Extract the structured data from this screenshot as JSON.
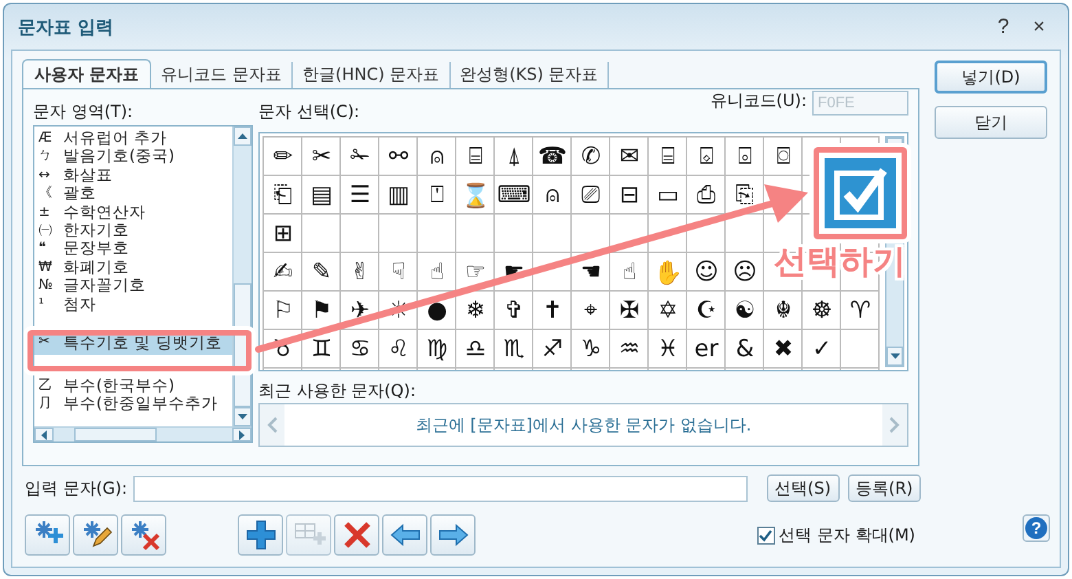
{
  "window": {
    "title": "문자표 입력",
    "controls": [
      "?",
      "×"
    ]
  },
  "tabs": [
    {
      "label": "사용자 문자표",
      "selected": true
    },
    {
      "label": "유니코드 문자표",
      "selected": false
    },
    {
      "label": "한글(HNC) 문자표",
      "selected": false
    },
    {
      "label": "완성형(KS) 문자표",
      "selected": false
    }
  ],
  "area_list": {
    "label": "문자 영역(T):",
    "items": [
      {
        "icon": "Æ",
        "label": "서유럽어 추가",
        "selected": false
      },
      {
        "icon": "ㄅ",
        "label": "발음기호(중국)",
        "selected": false
      },
      {
        "icon": "↔",
        "label": "화살표",
        "selected": false
      },
      {
        "icon": "《",
        "label": "괄호",
        "selected": false
      },
      {
        "icon": "±",
        "label": "수학연산자",
        "selected": false
      },
      {
        "icon": "㈠",
        "label": "한자기호",
        "selected": false
      },
      {
        "icon": "❝",
        "label": "문장부호",
        "selected": false
      },
      {
        "icon": "₩",
        "label": "화폐기호",
        "selected": false
      },
      {
        "icon": "№",
        "label": "글자꼴기호",
        "selected": false
      },
      {
        "icon": "¹",
        "label": "첨자",
        "selected": false
      },
      {
        "icon": "✂",
        "label": "특수기호 및 딩뱃기호",
        "selected": true
      },
      {
        "icon": "乙",
        "label": "부수(한국부수)",
        "selected": false
      },
      {
        "icon": "⺆",
        "label": "부수(한중일부수추가",
        "selected": false
      }
    ]
  },
  "char_select": {
    "label": "문자 선택(C):",
    "unicode_label": "유니코드(U):",
    "unicode_value": "F0FE",
    "unicode_disabled": true,
    "rows": [
      [
        "✏",
        "✂",
        "✁",
        "⚯",
        "⍝",
        "⌸",
        "⍋",
        "☎",
        "✆",
        "✉",
        "⌸",
        "⌺",
        "⌻",
        "⌼",
        null,
        null
      ],
      [
        "⎗",
        "▤",
        "☰",
        "▥",
        "⍞",
        "⌛",
        "⌨",
        "⍝",
        "⎚",
        "⊟",
        "▭",
        "⎙",
        "⎘",
        null,
        null,
        null
      ],
      [
        "⊞",
        null,
        null,
        null,
        null,
        null,
        null,
        null,
        null,
        null,
        null,
        null,
        null,
        null,
        null,
        null
      ],
      [
        "✍",
        "✎",
        "✌",
        "☟",
        "☝",
        "☞",
        "☛",
        null,
        "☚",
        "☝",
        "✋",
        "☺",
        "☹",
        null,
        null,
        null
      ],
      [
        "⚐",
        "⚑",
        "✈",
        "☼",
        "●",
        "❄",
        "✞",
        "✝",
        "⌖",
        "✠",
        "✡",
        "☪",
        "☯",
        "☬",
        "☸",
        "♈"
      ],
      [
        "♉",
        "♊",
        "♋",
        "♌",
        "♍",
        "♎",
        "♏",
        "♐",
        "♑",
        "♒",
        "♓",
        "er",
        "&",
        "✖",
        "✓",
        null
      ]
    ]
  },
  "recent": {
    "label": "최근 사용한 문자(Q):",
    "message": "최근에 [문자표]에서 사용한 문자가 없습니다."
  },
  "input": {
    "label": "입력 문자(G):",
    "buttons": [
      "선택(S)",
      "등록(R)"
    ]
  },
  "toolbar": [
    {
      "kind": "set-add",
      "disabled": false
    },
    {
      "kind": "set-edit",
      "disabled": false
    },
    {
      "kind": "set-delete",
      "disabled": false
    },
    {
      "kind": "add",
      "disabled": false
    },
    {
      "kind": "add-grid",
      "disabled": true
    },
    {
      "kind": "delete",
      "disabled": false
    },
    {
      "kind": "left",
      "disabled": false
    },
    {
      "kind": "right",
      "disabled": false
    }
  ],
  "enlarge": {
    "label": "선택 문자 확대(M)",
    "checked": true
  },
  "help": "?",
  "side_buttons": [
    {
      "label": "넣기(D)",
      "default": true
    },
    {
      "label": "닫기",
      "default": false
    }
  ],
  "annotation": {
    "label": "선택하기"
  }
}
